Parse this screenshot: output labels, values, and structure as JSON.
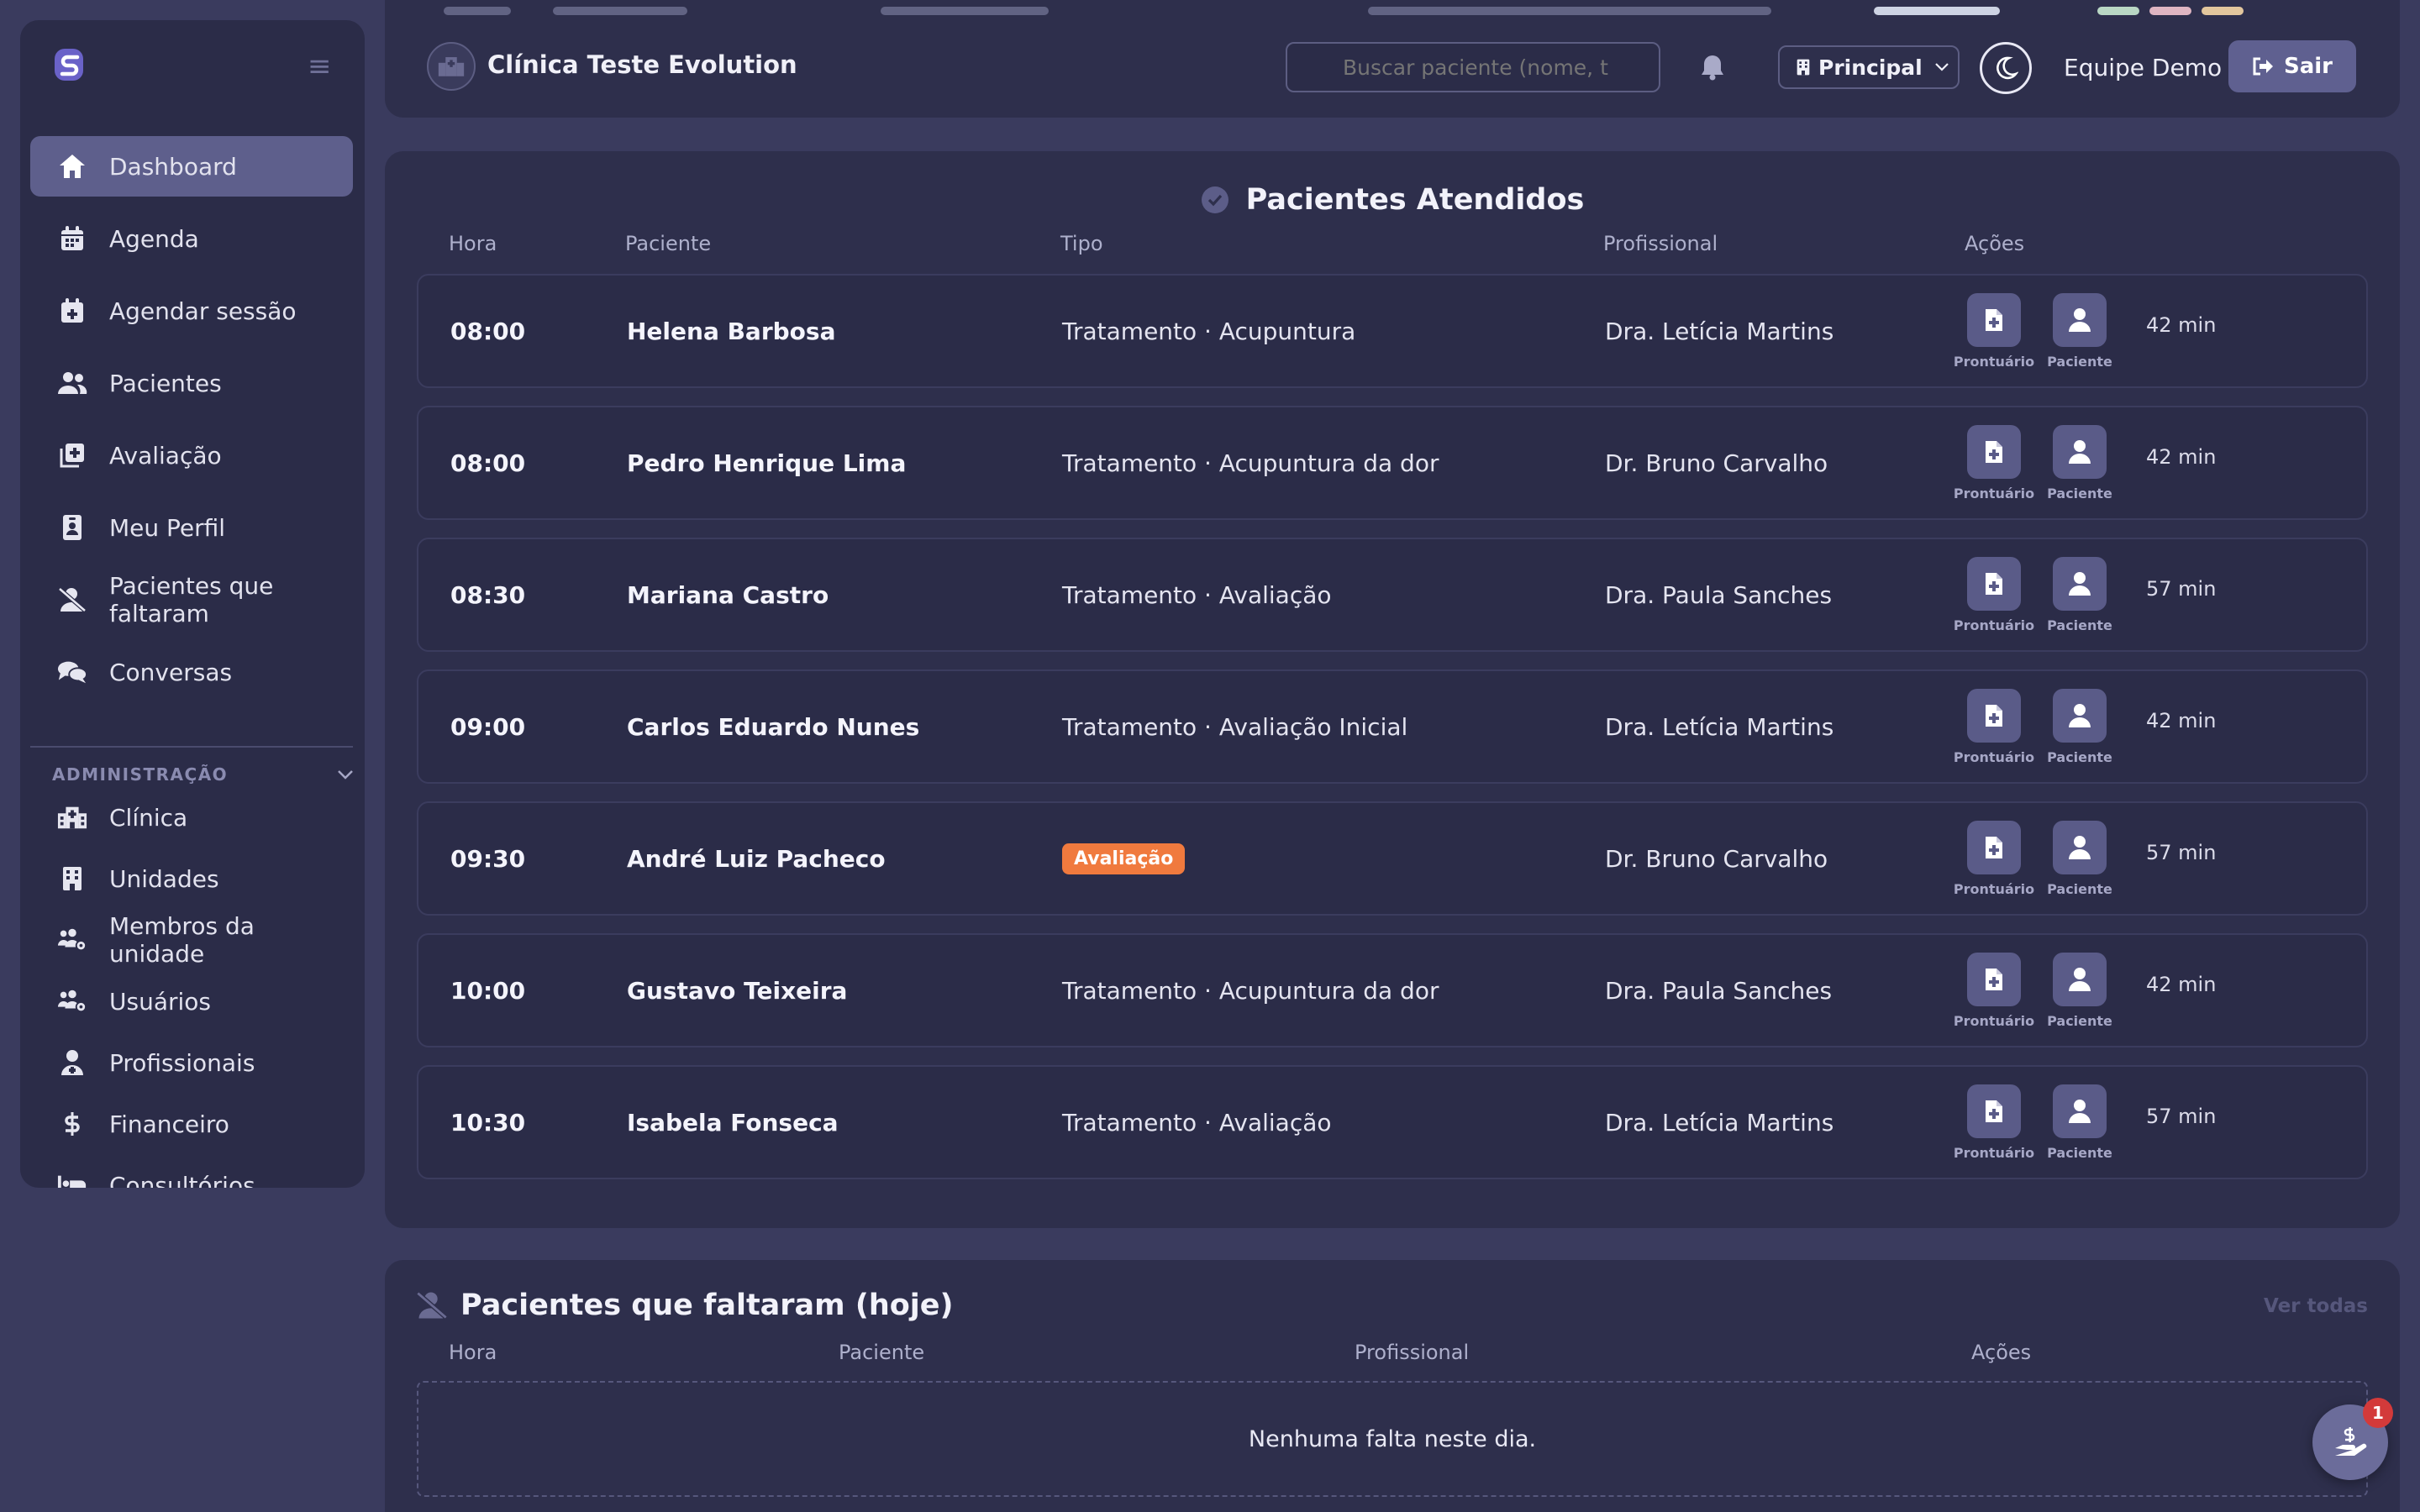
{
  "sidebar": {
    "nav": [
      {
        "label": "Dashboard",
        "icon": "home-icon",
        "active": true
      },
      {
        "label": "Agenda",
        "icon": "calendar-icon"
      },
      {
        "label": "Agendar sessão",
        "icon": "calendar-plus-icon"
      },
      {
        "label": "Pacientes",
        "icon": "users-icon"
      },
      {
        "label": "Avaliação",
        "icon": "clipboard-plus-icon"
      },
      {
        "label": "Meu Perfil",
        "icon": "id-badge-icon"
      },
      {
        "label": "Pacientes que faltaram",
        "icon": "user-slash-icon"
      },
      {
        "label": "Conversas",
        "icon": "chat-icon"
      }
    ],
    "admin_label": "ADMINISTRAÇÃO",
    "admin": [
      {
        "label": "Clínica",
        "icon": "hospital-icon"
      },
      {
        "label": "Unidades",
        "icon": "building-icon"
      },
      {
        "label": "Membros da unidade",
        "icon": "users-gear-icon"
      },
      {
        "label": "Usuários",
        "icon": "users-gear-icon"
      },
      {
        "label": "Profissionais",
        "icon": "doctor-icon"
      },
      {
        "label": "Financeiro",
        "icon": "dollar-icon"
      },
      {
        "label": "Consultórios",
        "icon": "bed-icon"
      }
    ]
  },
  "header": {
    "clinic_name": "Clínica Teste Evolution",
    "search_placeholder": "Buscar paciente (nome, t",
    "unit": "Principal",
    "team": "Equipe Demo",
    "logout": "Sair"
  },
  "attended": {
    "title": "Pacientes Atendidos",
    "columns": {
      "time": "Hora",
      "patient": "Paciente",
      "type": "Tipo",
      "professional": "Profissional",
      "actions": "Ações"
    },
    "action_labels": {
      "record": "Prontuário",
      "patient": "Paciente"
    },
    "rows": [
      {
        "time": "08:00",
        "patient": "Helena Barbosa",
        "type": "Tratamento · Acupuntura",
        "professional": "Dra. Letícia Martins",
        "duration": "42 min"
      },
      {
        "time": "08:00",
        "patient": "Pedro Henrique Lima",
        "type": "Tratamento · Acupuntura da dor",
        "professional": "Dr. Bruno Carvalho",
        "duration": "42 min"
      },
      {
        "time": "08:30",
        "patient": "Mariana Castro",
        "type": "Tratamento · Avaliação",
        "professional": "Dra. Paula Sanches",
        "duration": "57 min"
      },
      {
        "time": "09:00",
        "patient": "Carlos Eduardo Nunes",
        "type": "Tratamento · Avaliação Inicial",
        "professional": "Dra. Letícia Martins",
        "duration": "42 min"
      },
      {
        "time": "09:30",
        "patient": "André Luiz Pacheco",
        "type": "Avaliação",
        "type_badge": true,
        "professional": "Dr. Bruno Carvalho",
        "duration": "57 min"
      },
      {
        "time": "10:00",
        "patient": "Gustavo Teixeira",
        "type": "Tratamento · Acupuntura da dor",
        "professional": "Dra. Paula Sanches",
        "duration": "42 min"
      },
      {
        "time": "10:30",
        "patient": "Isabela Fonseca",
        "type": "Tratamento · Avaliação",
        "professional": "Dra. Letícia Martins",
        "duration": "57 min"
      }
    ]
  },
  "missed": {
    "title": "Pacientes que faltaram (hoje)",
    "see_all": "Ver todas",
    "columns": {
      "time": "Hora",
      "patient": "Paciente",
      "professional": "Profissional",
      "actions": "Ações"
    },
    "empty": "Nenhuma falta neste dia."
  },
  "fab": {
    "icon": "hand-dollar-icon",
    "count": "1"
  },
  "colors": {
    "accent": "#5e5f8c",
    "badge_orange": "#f07a3e",
    "notification_red": "#d33a3a"
  }
}
